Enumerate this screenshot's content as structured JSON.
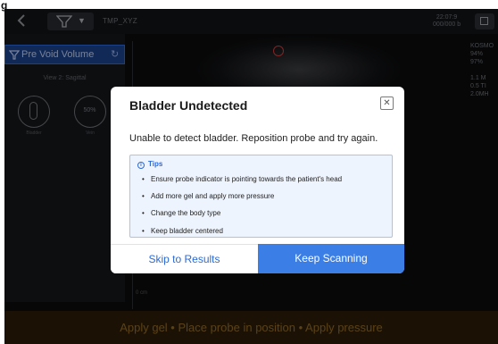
{
  "corner_glyph": "g",
  "topbar": {
    "back_icon": "chevron-left-icon",
    "probe_icon": "funnel-icon",
    "probe_caret": "▼",
    "probe_name": "TMP_XYZ",
    "clock_line1": "22:07:9",
    "clock_line2": "000/000 b"
  },
  "left_panel": {
    "pre_void_label": "Pre Void Volume",
    "refresh_icon": "refresh-icon",
    "view_label": "View 2: Sagittal",
    "circle2_value": "50%",
    "circle1_caption": "Bladder",
    "circle2_caption": "Vein"
  },
  "readout": [
    "KOSMO",
    "94%",
    "97%",
    "",
    "1.1 M",
    "0.5 TI",
    "2.0MH"
  ],
  "depth_label": "0 cm",
  "banner": {
    "text": "Apply gel • Place probe in position • Apply pressure"
  },
  "dialog": {
    "title": "Bladder Undetected",
    "close_glyph": "✕",
    "message": "Unable to detect bladder. Reposition probe and try again.",
    "tips_title": "Tips",
    "tips": [
      "Ensure probe indicator is pointing towards the patient's head",
      "Add more gel and apply more pressure",
      "Change the body type",
      "Keep bladder centered"
    ],
    "skip_label": "Skip to Results",
    "keep_label": "Keep Scanning"
  },
  "colors": {
    "accent": "#3a7ee6",
    "banner_text": "#8a6526",
    "pre_void_bg": "#1b3f86"
  }
}
